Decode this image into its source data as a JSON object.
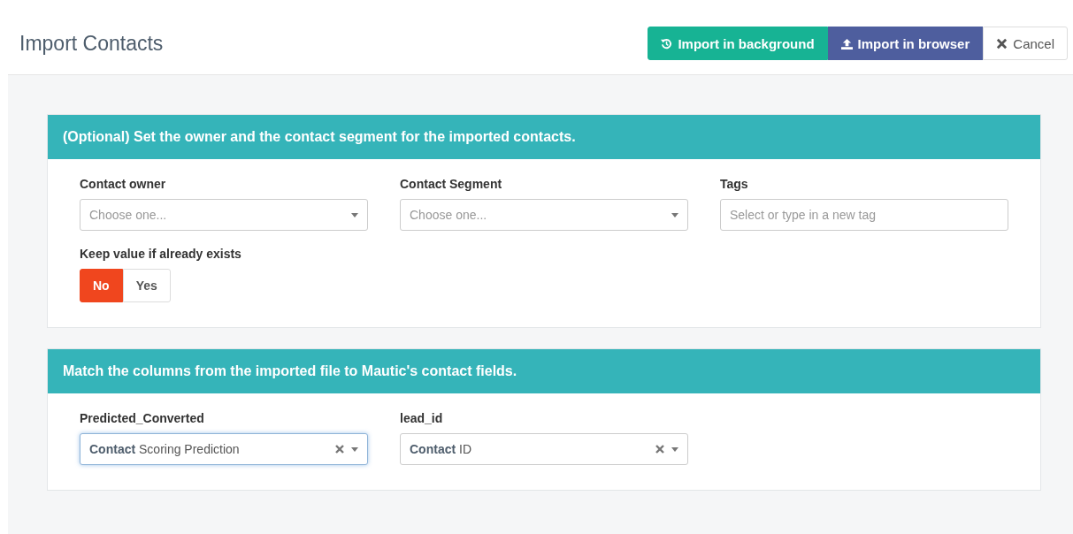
{
  "page_title": "Import Contacts",
  "actions": [
    {
      "kind": "background",
      "label": "Import in background"
    },
    {
      "kind": "browser",
      "label": "Import in browser"
    },
    {
      "kind": "cancel",
      "label": "Cancel"
    }
  ],
  "panels": [
    {
      "title": "(Optional) Set the owner and the contact segment for the imported contacts.",
      "fields": [
        {
          "kind": "select",
          "label": "Contact owner",
          "placeholder": "Choose one..."
        },
        {
          "kind": "select",
          "label": "Contact Segment",
          "placeholder": "Choose one..."
        },
        {
          "kind": "text",
          "label": "Tags",
          "placeholder": "Select or type in a new tag"
        }
      ],
      "toggle": {
        "label": "Keep value if already exists",
        "options": [
          {
            "label": "No",
            "selected": true
          },
          {
            "label": "Yes",
            "selected": false
          }
        ]
      }
    },
    {
      "title": "Match the columns from the imported file to Mautic's contact fields.",
      "fields": [
        {
          "kind": "select",
          "label": "Predicted_Converted",
          "value": "**Contact** Scoring Prediction",
          "focused": true
        },
        {
          "kind": "select",
          "label": "lead_id",
          "value": "**Contact** ID",
          "focused": false
        }
      ]
    }
  ]
}
